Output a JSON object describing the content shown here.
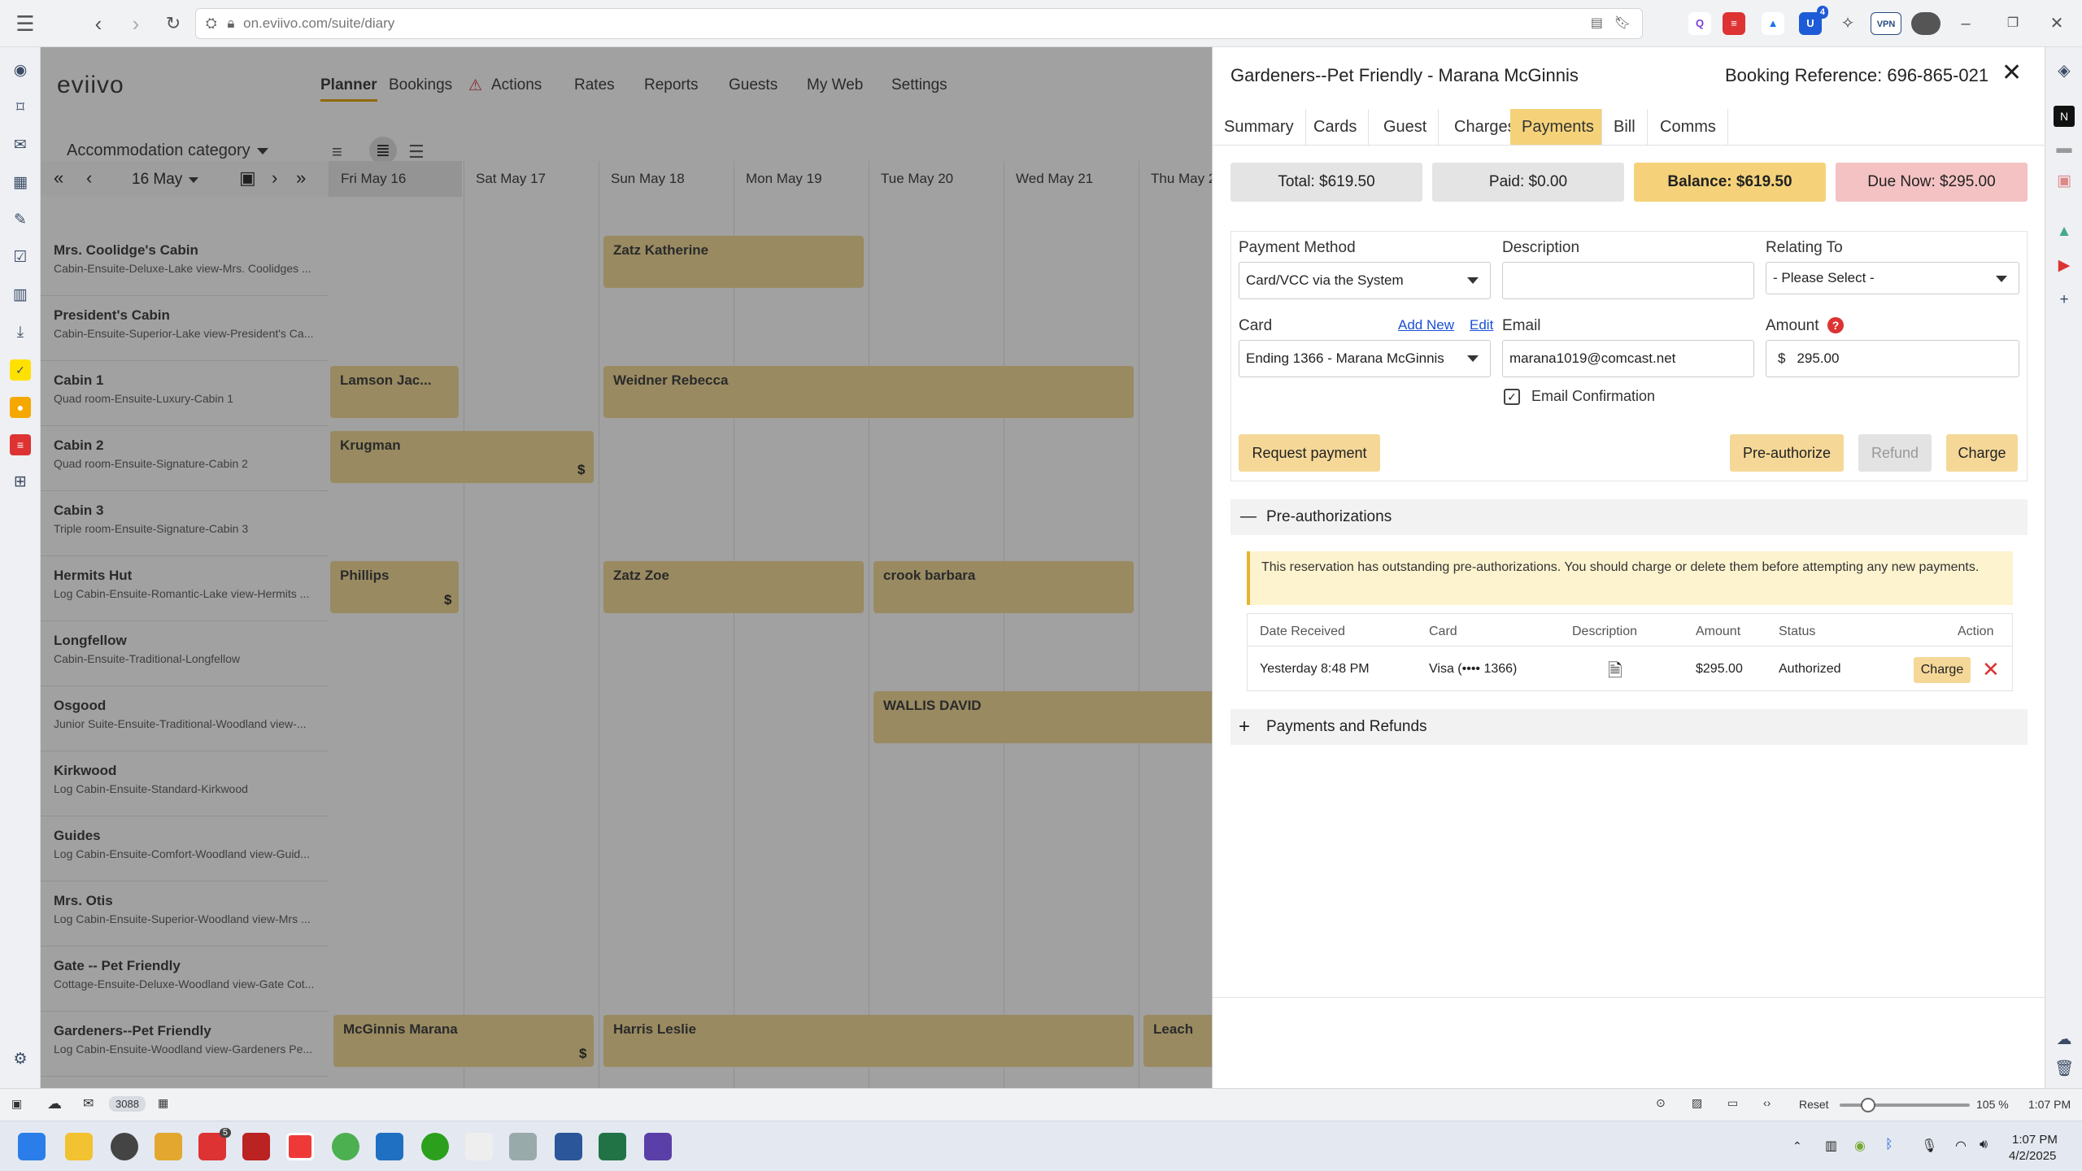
{
  "browser": {
    "url_domain": "on.eviivo.com",
    "url_path": "/suite/diary",
    "vpn_label": "VPN",
    "ext_badge": "4"
  },
  "app": {
    "logo": "eviivo",
    "nav": [
      "Planner",
      "Bookings",
      "Actions",
      "Rates",
      "Reports",
      "Guests",
      "My Web",
      "Settings"
    ],
    "category_label": "Accommodation category",
    "date": "16 May",
    "days": [
      "Fri May 16",
      "Sat May 17",
      "Sun May 18",
      "Mon May 19",
      "Tue May 20",
      "Wed May 21",
      "Thu May 2"
    ],
    "rooms": [
      {
        "name": "Mrs. Coolidge's Cabin",
        "desc": "Cabin-Ensuite-Deluxe-Lake view-Mrs. Coolidges ..."
      },
      {
        "name": "President's Cabin",
        "desc": "Cabin-Ensuite-Superior-Lake view-President's Ca..."
      },
      {
        "name": "Cabin 1",
        "desc": "Quad room-Ensuite-Luxury-Cabin 1"
      },
      {
        "name": "Cabin 2",
        "desc": "Quad room-Ensuite-Signature-Cabin 2"
      },
      {
        "name": "Cabin 3",
        "desc": "Triple room-Ensuite-Signature-Cabin 3"
      },
      {
        "name": "Hermits Hut",
        "desc": "Log Cabin-Ensuite-Romantic-Lake view-Hermits ..."
      },
      {
        "name": "Longfellow",
        "desc": "Cabin-Ensuite-Traditional-Longfellow"
      },
      {
        "name": "Osgood",
        "desc": "Junior Suite-Ensuite-Traditional-Woodland view-..."
      },
      {
        "name": "Kirkwood",
        "desc": "Log Cabin-Ensuite-Standard-Kirkwood"
      },
      {
        "name": "Guides",
        "desc": "Log Cabin-Ensuite-Comfort-Woodland view-Guid..."
      },
      {
        "name": "Mrs. Otis",
        "desc": "Log Cabin-Ensuite-Superior-Woodland view-Mrs ..."
      },
      {
        "name": "Gate -- Pet Friendly",
        "desc": "Cottage-Ensuite-Deluxe-Woodland view-Gate Cot..."
      },
      {
        "name": "Gardeners--Pet Friendly",
        "desc": "Log Cabin-Ensuite-Woodland view-Gardeners Pe..."
      }
    ],
    "bookings": [
      "Zatz Katherine",
      "Lamson Jac...",
      "Weidner Rebecca",
      "Krugman",
      "Phillips",
      "Zatz Zoe",
      "crook barbara",
      "WALLIS DAVID",
      "McGinnis Marana",
      "Harris Leslie",
      "Leach"
    ],
    "dollar": "$"
  },
  "panel": {
    "title": "Gardeners--Pet Friendly - Marana McGinnis",
    "reference": "Booking Reference: 696-865-021",
    "tabs": [
      "Summary",
      "Cards",
      "Guest",
      "Charges",
      "Payments",
      "Bill",
      "Comms"
    ],
    "summary": {
      "total": "Total: $619.50",
      "paid": "Paid: $0.00",
      "balance": "Balance: $619.50",
      "due": "Due Now: $295.00"
    },
    "form": {
      "method_label": "Payment Method",
      "method_value": "Card/VCC via the System",
      "desc_label": "Description",
      "desc_value": "",
      "relating_label": "Relating To",
      "relating_value": "- Please Select -",
      "card_label": "Card",
      "add_new": "Add New",
      "edit": "Edit",
      "card_value": "Ending 1366 - Marana McGinnis",
      "email_label": "Email",
      "email_value": "marana1019@comcast.net",
      "amount_label": "Amount",
      "currency": "$",
      "amount_value": "295.00",
      "email_confirm": "Email Confirmation"
    },
    "buttons": {
      "request": "Request payment",
      "preauth": "Pre-authorize",
      "refund": "Refund",
      "charge": "Charge"
    },
    "preauth": {
      "header": "Pre-authorizations",
      "warning": "This reservation has outstanding pre-authorizations. You should charge or delete them before attempting any new payments.",
      "columns": [
        "Date Received",
        "Card",
        "Description",
        "Amount",
        "Status",
        "Action"
      ],
      "row": {
        "date": "Yesterday 8:48 PM",
        "card": "Visa (•••• 1366)",
        "amount": "$295.00",
        "status": "Authorized",
        "action": "Charge"
      }
    },
    "payments_header": "Payments and Refunds"
  },
  "statusbar": {
    "count": "3088",
    "reset": "Reset",
    "zoom": "105 %",
    "time": "1:07 PM"
  },
  "taskbar": {
    "time": "1:07 PM",
    "date": "4/2/2025",
    "badge": "5"
  }
}
